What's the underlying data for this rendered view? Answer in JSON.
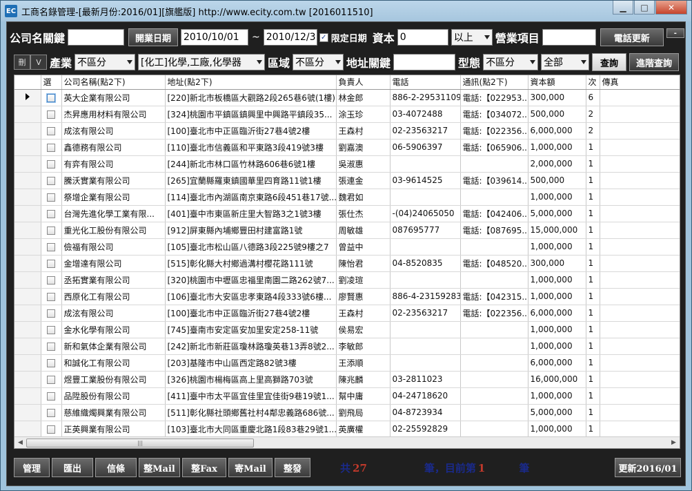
{
  "window": {
    "icon": "EC",
    "title": "工商名錄管理-[最新月份:2016/01][旗艦版] http://www.ecity.com.tw [2016011510]",
    "min": "▁",
    "max": "□",
    "close": "✕"
  },
  "search": {
    "company_label": "公司名關鍵",
    "company_value": "",
    "open_date_button": "開業日期",
    "date_from": "2010/10/01",
    "tilde": "~",
    "date_to": "2010/12/31",
    "limit_date_checked": true,
    "limit_date_label": "限定日期",
    "capital_label": "資本",
    "capital_value": "0",
    "capital_op": "以上",
    "business_label": "營業項目",
    "business_value": "",
    "phone_update_button": "電話更新",
    "dash": "-",
    "del_button": "刪",
    "v_button": "V",
    "industry_label": "產業",
    "industry_value": "不區分",
    "category_value": "[化工]化學,工廠,化學器",
    "region_label": "區域",
    "region_value": "不區分",
    "address_label": "地址關鍵",
    "address_value": "",
    "type_label": "型態",
    "type_value": "不區分",
    "scope_value": "全部",
    "query_button": "查詢",
    "advanced_query_button": "進階查詢"
  },
  "grid": {
    "columns": [
      "選",
      "公司名稱(點2下)",
      "地址(點2下)",
      "負責人",
      "電話",
      "通訊(點2下)",
      "資本額",
      "次",
      "傳真"
    ],
    "rows": [
      [
        "英大企業有限公司",
        "[220]新北市板橋區大觀路2段265巷6號(1樓)",
        "林金郎",
        "886-2-29531109",
        "電話:【022953...",
        "300,000",
        "6",
        ""
      ],
      [
        "杰昇應用材料有限公司",
        "[324]桃園市平鎮區鎮興里中興路平鎮段35...",
        "涂玉珍",
        "03-4072488",
        "電話:【034072...",
        "500,000",
        "2",
        ""
      ],
      [
        "成泫有限公司",
        "[100]臺北市中正區臨沂街27巷4號2樓",
        "王森村",
        "02-23563217",
        "電話:【022356...",
        "6,000,000",
        "2",
        ""
      ],
      [
        "鑫德務有限公司",
        "[110]臺北市信義區和平東路3段419號3樓",
        "劉嘉澳",
        "06-5906397",
        "電話:【065906...",
        "1,000,000",
        "1",
        ""
      ],
      [
        "有弈有限公司",
        "[244]新北市林口區竹林路606巷6號1樓",
        "吳淑惠",
        "",
        "",
        "2,000,000",
        "1",
        ""
      ],
      [
        "騰沃實業有限公司",
        "[265]宜蘭縣羅東鎮國華里四育路11號1樓",
        "張連金",
        "03-9614525",
        "電話:【039614...",
        "500,000",
        "1",
        ""
      ],
      [
        "祭增企業有限公司",
        "[114]臺北市內湖區南京東路6段451巷17號...",
        "魏君如",
        "",
        "",
        "1,000,000",
        "1",
        ""
      ],
      [
        "台灣先進化學工業有限...",
        "[401]臺中市東區新庄里大智路3之1號3樓",
        "張仕杰",
        "-(04)24065050",
        "電話:【042406...",
        "5,000,000",
        "1",
        ""
      ],
      [
        "重光化工股份有限公司",
        "[912]屏東縣內埔鄉豐田村建富路1號",
        "周敏雄",
        "087695777",
        "電話:【087695...",
        "15,000,000",
        "1",
        ""
      ],
      [
        "儉福有限公司",
        "[105]臺北市松山區八德路3段225號9樓之7",
        "曾益中",
        "",
        "",
        "1,000,000",
        "1",
        ""
      ],
      [
        "金增達有限公司",
        "[515]彰化縣大村鄉過溝村櫻花路111號",
        "陳怡君",
        "04-8520835",
        "電話:【048520...",
        "300,000",
        "1",
        ""
      ],
      [
        "丞拓實業有限公司",
        "[320]桃園市中壢區忠福里南園二路262號7...",
        "劉凌瑄",
        "",
        "",
        "1,000,000",
        "1",
        ""
      ],
      [
        "西原化工有限公司",
        "[106]臺北市大安區忠孝東路4段333號6樓...",
        "廖賢惠",
        "886-4-23159283",
        "電話:【042315...",
        "1,000,000",
        "1",
        ""
      ],
      [
        "成泫有限公司",
        "[100]臺北市中正區臨沂街27巷4號2樓",
        "王森村",
        "02-23563217",
        "電話:【022356...",
        "6,000,000",
        "1",
        ""
      ],
      [
        "金水化學有限公司",
        "[745]臺南市安定區安加里安定258-11號",
        "侯易宏",
        "",
        "",
        "1,000,000",
        "1",
        ""
      ],
      [
        "新和氣体企業有限公司",
        "[242]新北市新莊區瓊林路瓊英巷13弄8號2...",
        "李敏郎",
        "",
        "",
        "1,000,000",
        "1",
        ""
      ],
      [
        "和誠化工有限公司",
        "[203]基隆市中山區西定路82號3樓",
        "王添順",
        "",
        "",
        "6,000,000",
        "1",
        ""
      ],
      [
        "煜豐工業股份有限公司",
        "[326]桃園市楊梅區高上里高獅路703號",
        "陳兆麟",
        "03-2811023",
        "",
        "16,000,000",
        "1",
        ""
      ],
      [
        "品陞股份有限公司",
        "[411]臺中市太平區宜佳里宜佳街9巷19號1...",
        "幫中庸",
        "04-24718620",
        "",
        "1,000,000",
        "1",
        ""
      ],
      [
        "慈維織燭興業有限公司",
        "[511]彰化縣社頭鄉舊社村4鄰忠義路686號...",
        "劉飛局",
        "04-8723934",
        "",
        "5,000,000",
        "1",
        ""
      ],
      [
        "正英興業有限公司",
        "[103]臺北市大同區重慶北路1段83巷29號1...",
        "英廣權",
        "02-25592829",
        "",
        "1,000,000",
        "1",
        ""
      ]
    ],
    "scroll_grip": "|||"
  },
  "footer": {
    "buttons": [
      "管理",
      "匯出",
      "信條",
      "整Mail",
      "整Fax",
      "寄Mail",
      "整發"
    ],
    "total_prefix": "共",
    "total_count": "27",
    "total_suffix": "筆，目前第",
    "current_index": "1",
    "current_suffix": "筆",
    "update_button": "更新2016/01"
  }
}
